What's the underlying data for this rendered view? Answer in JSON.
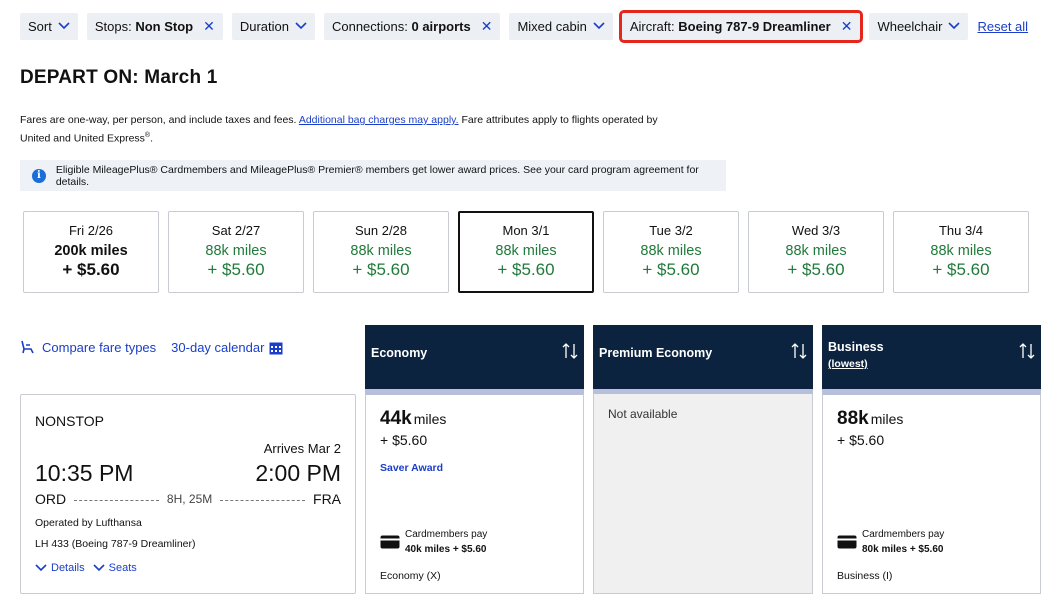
{
  "filters": {
    "sort": "Sort",
    "stops_label": "Stops:",
    "stops_value": "Non Stop",
    "duration": "Duration",
    "connections_label": "Connections:",
    "connections_value": "0 airports",
    "cabin": "Mixed cabin",
    "aircraft_label": "Aircraft:",
    "aircraft_value": "Boeing 787-9 Dreamliner",
    "wheelchair": "Wheelchair",
    "reset": "Reset all",
    "remove_glyph": "✕"
  },
  "depart_heading": "DEPART ON: March 1",
  "fares_note": {
    "text1": "Fares are one-way, per person, and include taxes and fees.",
    "link": "Additional bag charges may apply.",
    "text2": "Fare attributes apply to flights operated by United and United Express",
    "sup": "®",
    "end": "."
  },
  "info_banner": {
    "icon": "i",
    "text": "Eligible MileagePlus® Cardmembers and MileagePlus® Premier® members get lower award prices. See your card program agreement for details."
  },
  "dates": [
    {
      "day": "Fri 2/26",
      "miles": "200k miles",
      "price": "+ $5.60",
      "selected": false,
      "color": "black"
    },
    {
      "day": "Sat 2/27",
      "miles": "88k miles",
      "price": "+ $5.60",
      "selected": false,
      "color": "green"
    },
    {
      "day": "Sun 2/28",
      "miles": "88k miles",
      "price": "+ $5.60",
      "selected": false,
      "color": "green"
    },
    {
      "day": "Mon 3/1",
      "miles": "88k miles",
      "price": "+ $5.60",
      "selected": true,
      "color": "green"
    },
    {
      "day": "Tue 3/2",
      "miles": "88k miles",
      "price": "+ $5.60",
      "selected": false,
      "color": "green"
    },
    {
      "day": "Wed 3/3",
      "miles": "88k miles",
      "price": "+ $5.60",
      "selected": false,
      "color": "green"
    },
    {
      "day": "Thu 3/4",
      "miles": "88k miles",
      "price": "+ $5.60",
      "selected": false,
      "color": "green"
    }
  ],
  "tools": {
    "compare": "Compare fare types",
    "calendar": "30-day calendar"
  },
  "fare_columns": {
    "economy": "Economy",
    "premium": "Premium Economy",
    "business": "Business",
    "business_sub": "(lowest)"
  },
  "flight": {
    "type": "NONSTOP",
    "arrives": "Arrives Mar 2",
    "depart_time": "10:35 PM",
    "arrive_time": "2:00 PM",
    "origin": "ORD",
    "destination": "FRA",
    "duration": "8H, 25M",
    "operated_by": "Operated by Lufthansa",
    "flight_number": "LH 433 (Boeing 787-9 Dreamliner)",
    "details": "Details",
    "seats": "Seats"
  },
  "economy": {
    "miles": "44k",
    "miles_unit": "miles",
    "tax": "+ $5.60",
    "tag": "Saver Award",
    "card_line1": "Cardmembers pay",
    "card_line2": "40k miles + $5.60",
    "cabin": "Economy (X)"
  },
  "premium": {
    "status": "Not available"
  },
  "business": {
    "miles": "88k",
    "miles_unit": "miles",
    "tax": "+ $5.60",
    "card_line1": "Cardmembers pay",
    "card_line2": "80k miles + $5.60",
    "cabin": "Business (I)"
  },
  "colors": {
    "accent_blue": "#1a3ec9",
    "header_navy": "#0c2340",
    "green": "#207a3a",
    "highlight_red": "#e4261c"
  }
}
